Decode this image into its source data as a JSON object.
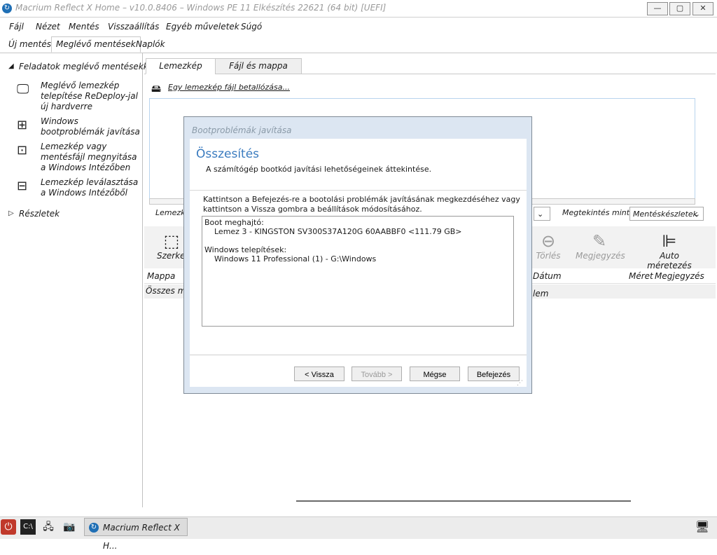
{
  "window": {
    "title": "Macrium Reflect X Home – v10.0.8406 – Windows PE 11 Elkészítés 22621 (64 bit)  [UEFI]",
    "logo_glyph": "↻",
    "minimize": "—",
    "maximize": "▢",
    "close": "✕"
  },
  "menu": [
    "Fájl",
    "Nézet",
    "Mentés",
    "Visszaállítás",
    "Egyéb műveletek",
    "Súgó"
  ],
  "main_tabs": [
    "Új mentés",
    "Meglévő mentések",
    "Naplók"
  ],
  "left_panel": {
    "section_title": "Feladatok meglévő mentésekkel",
    "tasks": [
      "Meglévő lemezkép telepítése ReDeploy-jal új hardverre",
      "Windows bootproblémák javítása",
      "Lemezkép vagy mentésfájl megnyitása a Windows Intézőben",
      "Lemezkép leválasztása a Windows Intézőből"
    ],
    "details": "Részletek"
  },
  "sub_tabs": [
    "Lemezkép",
    "Fájl és mappa"
  ],
  "browse_link": "Egy lemezkép fájl betallózása...",
  "filter_label_left": "Lemezkép",
  "preview_label": "Megtekintés mint",
  "preview_select": "Mentéskészletek",
  "toolbar": {
    "edit": "Szerkes",
    "delete": "Törlés",
    "note": "Megjegyzés",
    "autosize": "Auto méretezés"
  },
  "table": {
    "col_folder": "Mappa",
    "col_date": "Dátum",
    "col_size": "Méret",
    "col_note": "Megjegyzés",
    "row_left": "Összes ma",
    "row_right": "lem"
  },
  "dialog": {
    "title": "Bootproblémák javítása",
    "heading": "Összesítés",
    "subheading": "A számítógép bootkód javítási lehetőségeinek áttekintése.",
    "instruction": "Kattintson a Befejezés-re a bootolási problémák javításának megkezdéséhez vagy kattintson a Vissza gombra a beállítások módosításához.",
    "boot_drive_label": "Boot meghajtó:",
    "boot_drive_value": "Lemez 3 - KINGSTON SV300S37A120G 60AABBF0 <111.79 GB>",
    "windows_label": "Windows telepítések:",
    "windows_value": "Windows 11 Professional (1) - G:\\Windows",
    "btn_back": "< Vissza",
    "btn_next": "Tovább >",
    "btn_cancel": "Mégse",
    "btn_finish": "Befejezés"
  },
  "taskbar": {
    "app_label": "Macrium Reflect X H..."
  }
}
